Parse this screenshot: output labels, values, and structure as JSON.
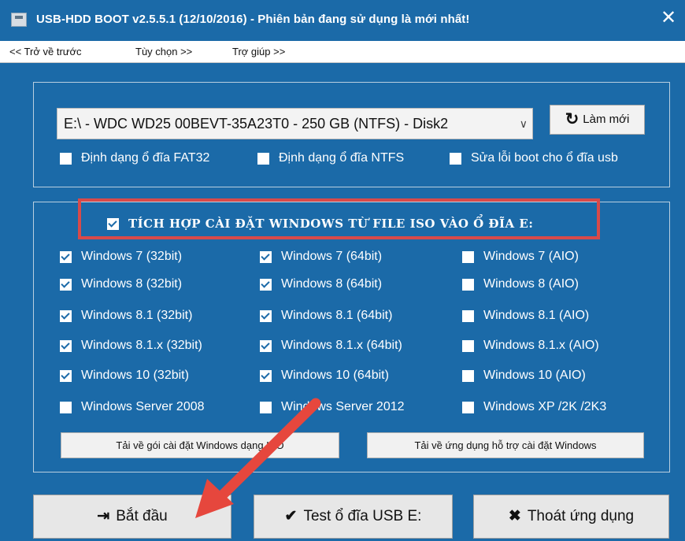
{
  "window": {
    "title": "USB-HDD BOOT v2.5.5.1 (12/10/2016) - Phiên bản đang sử dụng là mới nhất!",
    "close_glyph": "✕"
  },
  "menu": [
    "<< Trở về trước",
    "Tùy chọn >>",
    "Trợ giúp >>"
  ],
  "drive": {
    "selected": "E:\\ - WDC WD25 00BEVT-35A23T0 - 250 GB (NTFS) - Disk2",
    "dropdown_glyph": "∨",
    "refresh_label": "Làm mới",
    "refresh_icon": "refresh-icon"
  },
  "options": [
    {
      "label": "Định dạng ổ đĩa FAT32",
      "checked": false
    },
    {
      "label": "Định dạng ổ đĩa NTFS",
      "checked": false
    },
    {
      "label": "Sửa lỗi boot cho ổ đĩa usb",
      "checked": false
    }
  ],
  "integrate": {
    "label": "TÍCH HỢP CÀI ĐẶT WINDOWS TỪ FILE ISO VÀO Ổ ĐĨA E:",
    "checked": true
  },
  "windows_options": [
    [
      {
        "label": "Windows 7 (32bit)",
        "checked": true
      },
      {
        "label": "Windows 7 (64bit)",
        "checked": true
      },
      {
        "label": "Windows 7 (AIO)",
        "checked": false
      }
    ],
    [
      {
        "label": "Windows 8 (32bit)",
        "checked": true
      },
      {
        "label": "Windows 8 (64bit)",
        "checked": true
      },
      {
        "label": "Windows 8 (AIO)",
        "checked": false
      }
    ],
    [
      {
        "label": "Windows 8.1 (32bit)",
        "checked": true
      },
      {
        "label": "Windows 8.1 (64bit)",
        "checked": true
      },
      {
        "label": "Windows 8.1 (AIO)",
        "checked": false
      }
    ],
    [
      {
        "label": "Windows 8.1.x (32bit)",
        "checked": true
      },
      {
        "label": "Windows 8.1.x (64bit)",
        "checked": true
      },
      {
        "label": "Windows 8.1.x (AIO)",
        "checked": false
      }
    ],
    [
      {
        "label": "Windows 10 (32bit)",
        "checked": true
      },
      {
        "label": "Windows 10 (64bit)",
        "checked": true
      },
      {
        "label": "Windows 10 (AIO)",
        "checked": false
      }
    ],
    [
      {
        "label": "Windows Server 2008",
        "checked": false
      },
      {
        "label": "Windows Server 2012",
        "checked": false
      },
      {
        "label": "Windows XP /2K /2K3",
        "checked": false
      }
    ]
  ],
  "downloads": {
    "iso_label": "Tải về gói cài đặt Windows dạng ISO",
    "support_label": "Tải về ứng dụng hỗ trợ cài đặt Windows"
  },
  "actions": {
    "start_label": "Bắt đầu",
    "start_icon": "enter-icon",
    "test_label": "Test ổ đĩa USB E:",
    "test_icon": "check-icon",
    "exit_label": "Thoát ứng dụng",
    "exit_icon": "close-icon"
  },
  "colors": {
    "window_bg": "#1b6aa8",
    "highlight": "#d84a4a",
    "arrow": "#e6473d"
  }
}
